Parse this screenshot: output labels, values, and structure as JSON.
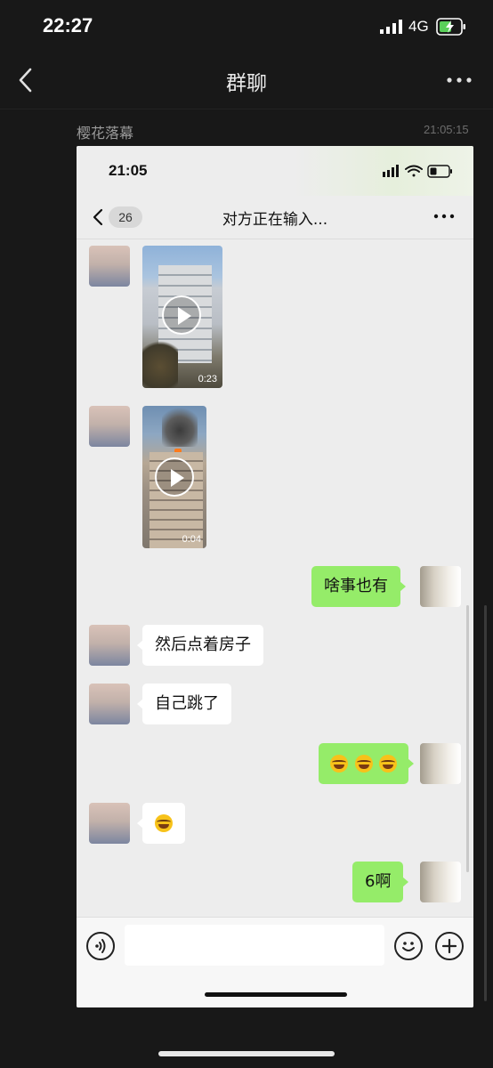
{
  "status": {
    "time": "22:27",
    "network": "4G"
  },
  "nav": {
    "title": "群聊"
  },
  "message": {
    "sender": "樱花落幕",
    "timestamp": "21:05:15"
  },
  "screenshot": {
    "status_time": "21:05",
    "nav": {
      "unread_count": "26",
      "title": "对方正在输入..."
    },
    "videos": [
      {
        "duration": "0:23"
      },
      {
        "duration": "0:04"
      }
    ],
    "messages": [
      {
        "side": "right",
        "text": "啥事也有"
      },
      {
        "side": "left",
        "text": "然后点着房子"
      },
      {
        "side": "left",
        "text": "自己跳了"
      },
      {
        "side": "right",
        "emoji": [
          "laughing-crying-emoji",
          "laughing-crying-emoji",
          "laughing-crying-emoji"
        ]
      },
      {
        "side": "left",
        "emoji": [
          "laughing-crying-emoji"
        ]
      },
      {
        "side": "right",
        "text": "6啊"
      }
    ],
    "composer": {
      "input_value": ""
    }
  },
  "colors": {
    "outer_bg": "#181818",
    "chat_bg": "#ededed",
    "my_bubble": "#95ec69",
    "their_bubble": "#ffffff",
    "battery_charge": "#5ad05a"
  }
}
